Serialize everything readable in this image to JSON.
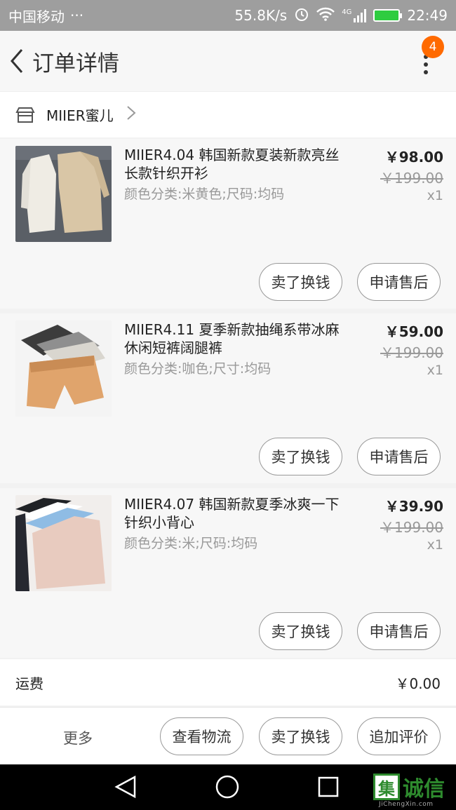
{
  "status_bar": {
    "carrier": "中国移动",
    "dots": "···",
    "speed": "55.8K/s",
    "network": "4G",
    "time": "22:49"
  },
  "header": {
    "title": "订单详情",
    "badge_count": "4"
  },
  "shop": {
    "name": "MIIER蜜儿"
  },
  "items": [
    {
      "name": "MIIER4.04  韩国新款夏装新款亮丝长款针织开衫",
      "spec": "颜色分类:米黄色;尺码:均码",
      "price": "￥98.00",
      "original_price": "￥199.00",
      "quantity": "x1",
      "sell_label": "卖了换钱",
      "after_sale_label": "申请售后"
    },
    {
      "name": "MIIER4.11 夏季新款抽绳系带冰麻休闲短裤阔腿裤",
      "spec": "颜色分类:咖色;尺寸:均码",
      "price": "￥59.00",
      "original_price": "￥199.00",
      "quantity": "x1",
      "sell_label": "卖了换钱",
      "after_sale_label": "申请售后"
    },
    {
      "name": "MIIER4.07 韩国新款夏季冰爽一下针织小背心",
      "spec": "颜色分类:米;尺码:均码",
      "price": "￥39.90",
      "original_price": "￥199.00",
      "quantity": "x1",
      "sell_label": "卖了换钱",
      "after_sale_label": "申请售后"
    }
  ],
  "freight": {
    "label": "运费",
    "value": "￥0.00"
  },
  "bottom_bar": {
    "more": "更多",
    "logistics": "查看物流",
    "sell": "卖了换钱",
    "review": "追加评价"
  },
  "watermark": {
    "logo_char": "集",
    "text": "诚信",
    "sub": "JiChengXin.com"
  },
  "colors": {
    "badge": "#ff6a00",
    "battery": "#2ecc40",
    "watermark": "#2e8b2e"
  }
}
